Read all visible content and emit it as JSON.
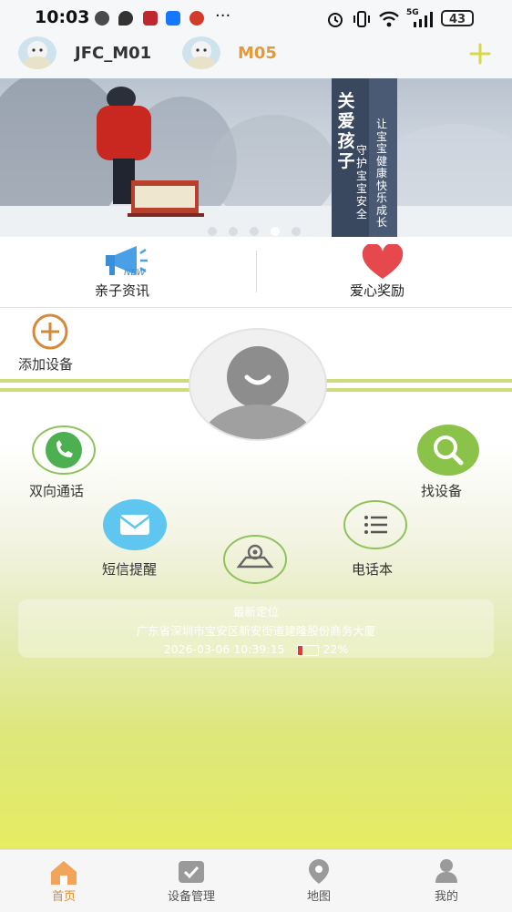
{
  "status_bar": {
    "time": "10:03",
    "more": "···",
    "network": "5G",
    "battery": "43"
  },
  "devices": [
    {
      "name": "JFC_M01",
      "color": "#222222"
    },
    {
      "name": "M05",
      "color": "#e59a3a"
    }
  ],
  "banner": {
    "title": "关爱孩子",
    "line1": "守护宝宝安全",
    "line2": "让宝宝健康快乐成长"
  },
  "quick_links": [
    {
      "label": "亲子资讯",
      "badge": "NEW",
      "icon": "megaphone-icon"
    },
    {
      "label": "爱心奖励",
      "icon": "heart-icon"
    }
  ],
  "add_device": {
    "label": "添加设备"
  },
  "functions": {
    "call": "双向通话",
    "find": "找设备",
    "sms": "短信提醒",
    "phonebook": "电话本",
    "locate_icon": "location-icon"
  },
  "location": {
    "status": "最新定位",
    "address": "广东省深圳市宝安区新安街道建隆股份商务大厦",
    "time": "2026-03-06 10:39:15",
    "battery": "22%",
    "battery_level": 0.22
  },
  "tabs": [
    {
      "label": "首页",
      "icon": "home-icon",
      "active": true
    },
    {
      "label": "设备管理",
      "icon": "device-manage-icon",
      "active": false
    },
    {
      "label": "地图",
      "icon": "map-pin-icon",
      "active": false
    },
    {
      "label": "我的",
      "icon": "profile-icon",
      "active": false
    }
  ],
  "colors": {
    "accent": "#e58a2a",
    "green": "#8bc34a",
    "plus": "#d8d84a"
  }
}
